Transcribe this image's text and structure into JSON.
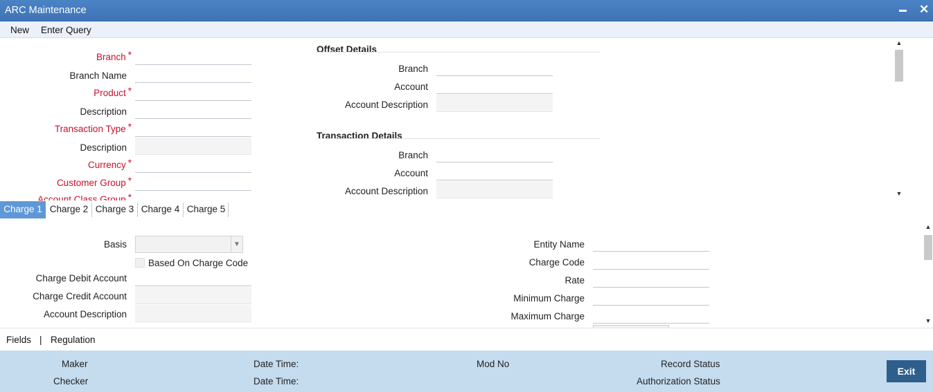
{
  "window": {
    "title": "ARC Maintenance"
  },
  "menu": {
    "new": "New",
    "enter_query": "Enter Query"
  },
  "header_fields": {
    "branch": {
      "label": "Branch",
      "value": ""
    },
    "branch_name": {
      "label": "Branch Name",
      "value": ""
    },
    "product": {
      "label": "Product",
      "value": ""
    },
    "product_description": {
      "label": "Description",
      "value": ""
    },
    "transaction_type": {
      "label": "Transaction Type",
      "value": ""
    },
    "transaction_description": {
      "label": "Description",
      "value": ""
    },
    "currency": {
      "label": "Currency",
      "value": ""
    },
    "customer_group": {
      "label": "Customer Group",
      "value": ""
    },
    "account_class_group": {
      "label": "Account Class Group"
    },
    "required_marker": "*"
  },
  "offset_details": {
    "title": "Offset Details",
    "branch": "Branch",
    "account": "Account",
    "account_description": "Account Description"
  },
  "transaction_details": {
    "title": "Transaction Details",
    "branch": "Branch",
    "account": "Account",
    "account_description": "Account Description"
  },
  "tabs": [
    "Charge 1",
    "Charge 2",
    "Charge 3",
    "Charge 4",
    "Charge 5"
  ],
  "active_tab": "Charge 1",
  "charge": {
    "basis": "Basis",
    "basis_value": "",
    "based_on_charge_code": "Based On Charge Code",
    "charge_debit_account": "Charge Debit Account",
    "charge_credit_account": "Charge Credit Account",
    "account_description": "Account Description",
    "entity_name": "Entity Name",
    "charge_code": "Charge Code",
    "rate": "Rate",
    "minimum_charge": "Minimum Charge",
    "maximum_charge": "Maximum Charge"
  },
  "bottom_nav": {
    "fields": "Fields",
    "separator": "|",
    "regulation": "Regulation"
  },
  "footer": {
    "maker": "Maker",
    "checker": "Checker",
    "date_time_1": "Date Time:",
    "date_time_2": "Date Time:",
    "mod_no": "Mod No",
    "record_status": "Record Status",
    "authorization_status": "Authorization Status",
    "exit": "Exit"
  }
}
